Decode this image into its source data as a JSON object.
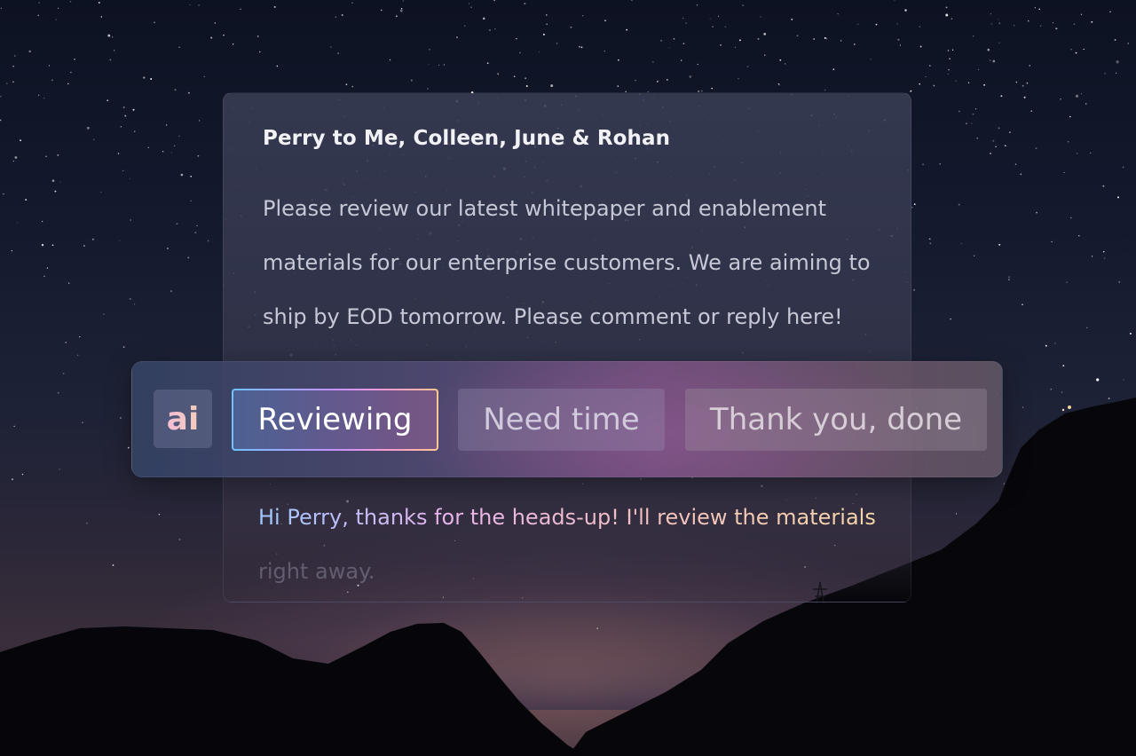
{
  "email": {
    "from_line": "Perry to Me, Colleen, June & Rohan",
    "body_lines": [
      "Please review our latest whitepaper and enablement",
      "materials for our enterprise customers. We are aiming to",
      "ship by EOD tomorrow.  Please comment or reply here!"
    ]
  },
  "reply_bar": {
    "badge": "ai",
    "suggestions": [
      {
        "label": "Reviewing",
        "selected": true
      },
      {
        "label": "Need time",
        "selected": false
      },
      {
        "label": "Thank you, done",
        "selected": false
      }
    ]
  },
  "draft_reply": {
    "line1": "Hi Perry, thanks for the heads-up!  I'll review the materials",
    "line2": "right away."
  },
  "colors": {
    "selected_border_gradient": [
      "#6ec3ff",
      "#c890ff",
      "#ffa0c8",
      "#ffc890"
    ],
    "reply_text_gradient": [
      "#9fc8ff",
      "#e8b4ec",
      "#f2c0c0",
      "#f6d8a6"
    ]
  }
}
